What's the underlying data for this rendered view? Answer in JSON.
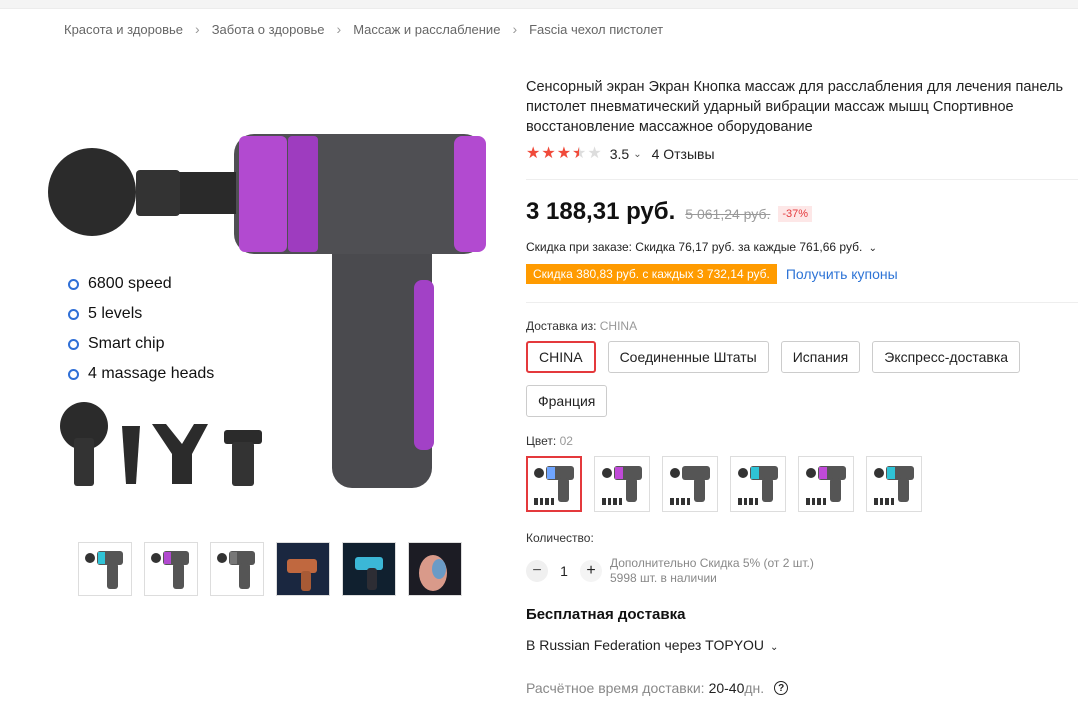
{
  "breadcrumb": [
    "Красота и здоровье",
    "Забота о здоровье",
    "Массаж и расслабление",
    "Fascia чехол пистолет"
  ],
  "gallery": {
    "features": [
      "6800 speed",
      "5 levels",
      "Smart chip",
      "4 massage heads"
    ],
    "thumb_count": 6
  },
  "product": {
    "title": "Сенсорный экран Экран Кнопка массаж для расслабления для лечения панель пистолет пневматический ударный вибрации массаж мышц Спортивное восстановление массажное оборудование",
    "rating": 3.5,
    "rating_text": "3.5",
    "reviews": "4 Отзывы",
    "price": "3 188,31 руб.",
    "old_price": "5 061,24 руб.",
    "discount": "-37%",
    "order_discount": "Скидка при заказе: Скидка 76,17 руб. за каждые 761,66 руб.",
    "coupon_badge": "Скидка 380,83 руб. с каждых 3 732,14 руб.",
    "get_coupons": "Получить купоны"
  },
  "shipping_from": {
    "label": "Доставка из:",
    "value": "CHINA",
    "options": [
      "CHINA",
      "Соединенные Штаты",
      "Испания",
      "Экспресс-доставка",
      "Франция"
    ],
    "selected": 0
  },
  "color": {
    "label": "Цвет:",
    "value": "02",
    "swatches": [
      "#6fa5ff",
      "#c04ad8",
      "#555555",
      "#2fc3d6",
      "#c04ad8",
      "#2fc3d6"
    ],
    "selected": 0
  },
  "quantity": {
    "label": "Количество:",
    "value": "1",
    "minus": "−",
    "plus": "+",
    "extra_discount": "Дополнительно Скидка 5% (от 2 шт.)",
    "stock": "5998 шт. в наличии"
  },
  "delivery": {
    "title": "Бесплатная доставка",
    "route": "В Russian Federation через TOPYOU",
    "time_label": "Расчётное время доставки:",
    "time_value": "20-40",
    "time_unit": "дн."
  },
  "colors": {
    "accent": "#e4393c",
    "coupon": "#ff9b00",
    "link": "#2e74d6",
    "gun_body": "#4a4a4e",
    "gun_accent": "#b24ad0"
  }
}
